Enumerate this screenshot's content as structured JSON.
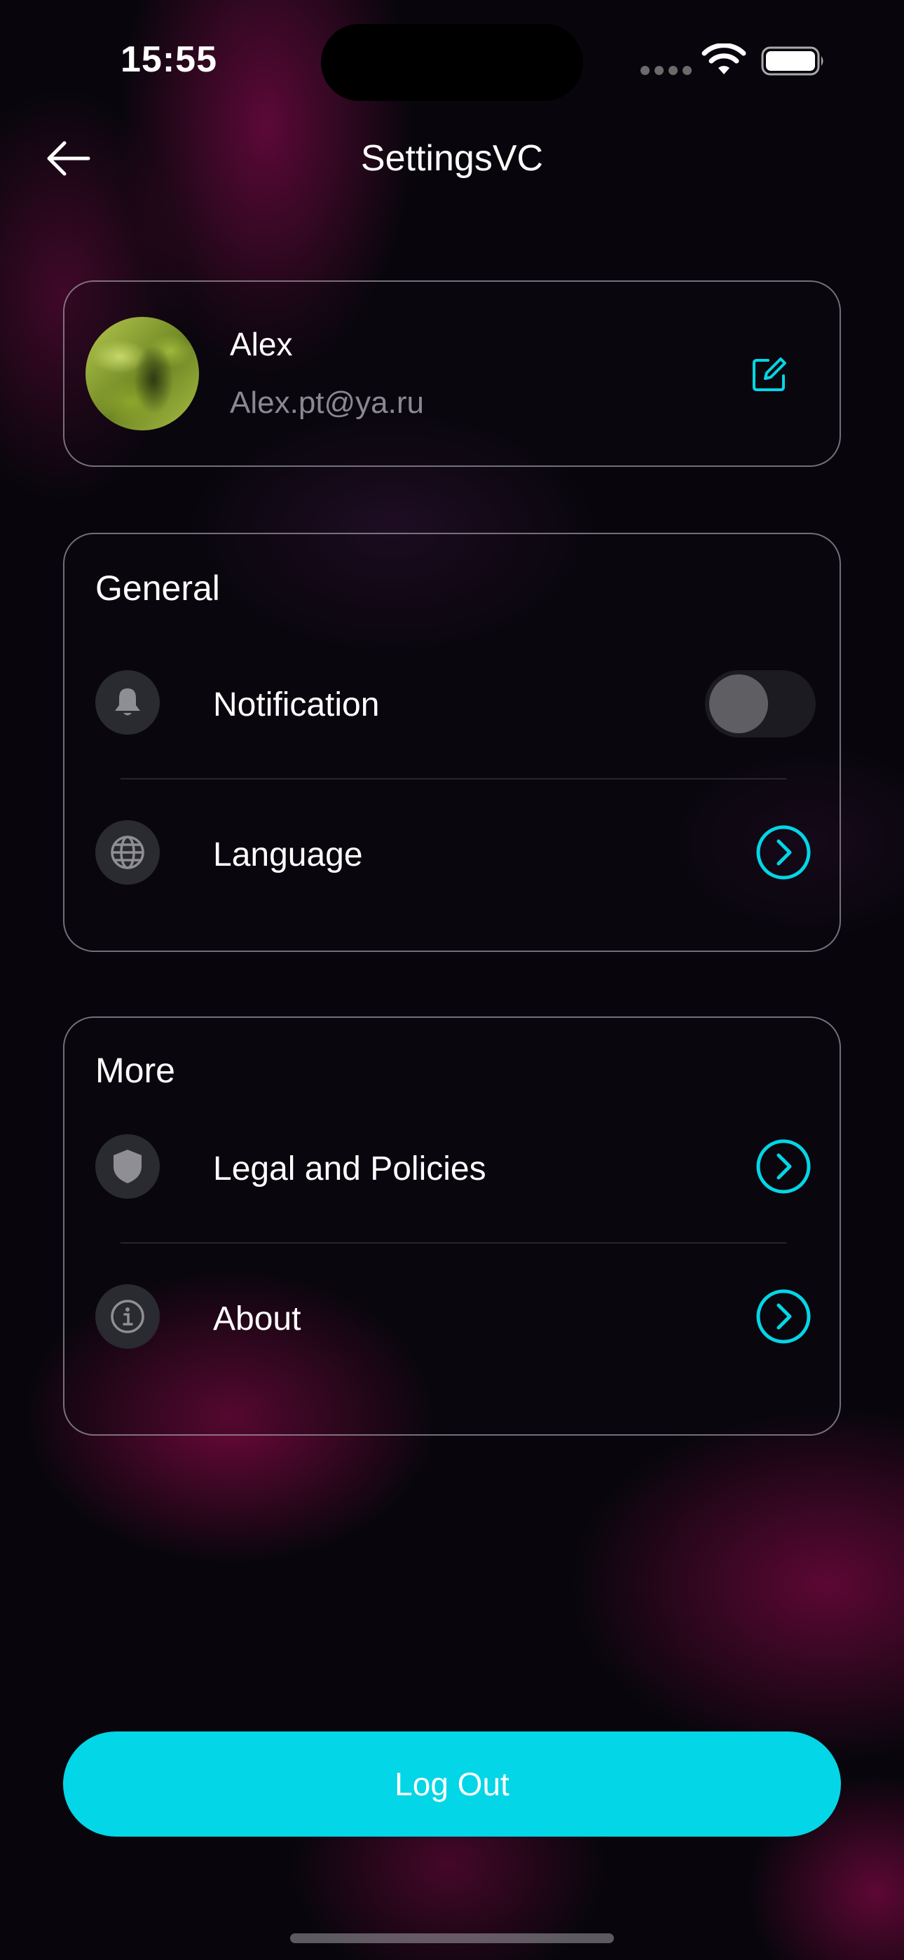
{
  "status_bar": {
    "time": "15:55"
  },
  "nav": {
    "title": "SettingsVC",
    "back_icon": "arrow-left-icon"
  },
  "profile": {
    "name": "Alex",
    "email": "Alex.pt@ya.ru",
    "edit_icon": "edit-icon"
  },
  "general": {
    "title": "General",
    "items": [
      {
        "label": "Notification",
        "icon": "bell-icon",
        "control": "toggle",
        "enabled": false
      },
      {
        "label": "Language",
        "icon": "globe-icon",
        "control": "chevron"
      }
    ]
  },
  "more": {
    "title": "More",
    "items": [
      {
        "label": "Legal and Policies",
        "icon": "shield-icon",
        "control": "chevron"
      },
      {
        "label": "About",
        "icon": "info-icon",
        "control": "chevron"
      }
    ]
  },
  "logout": {
    "label": "Log Out"
  },
  "colors": {
    "accent": "#03d6e6",
    "background": "#08060c",
    "card_border": "#c8c8d2",
    "muted_text": "#8a8890"
  }
}
